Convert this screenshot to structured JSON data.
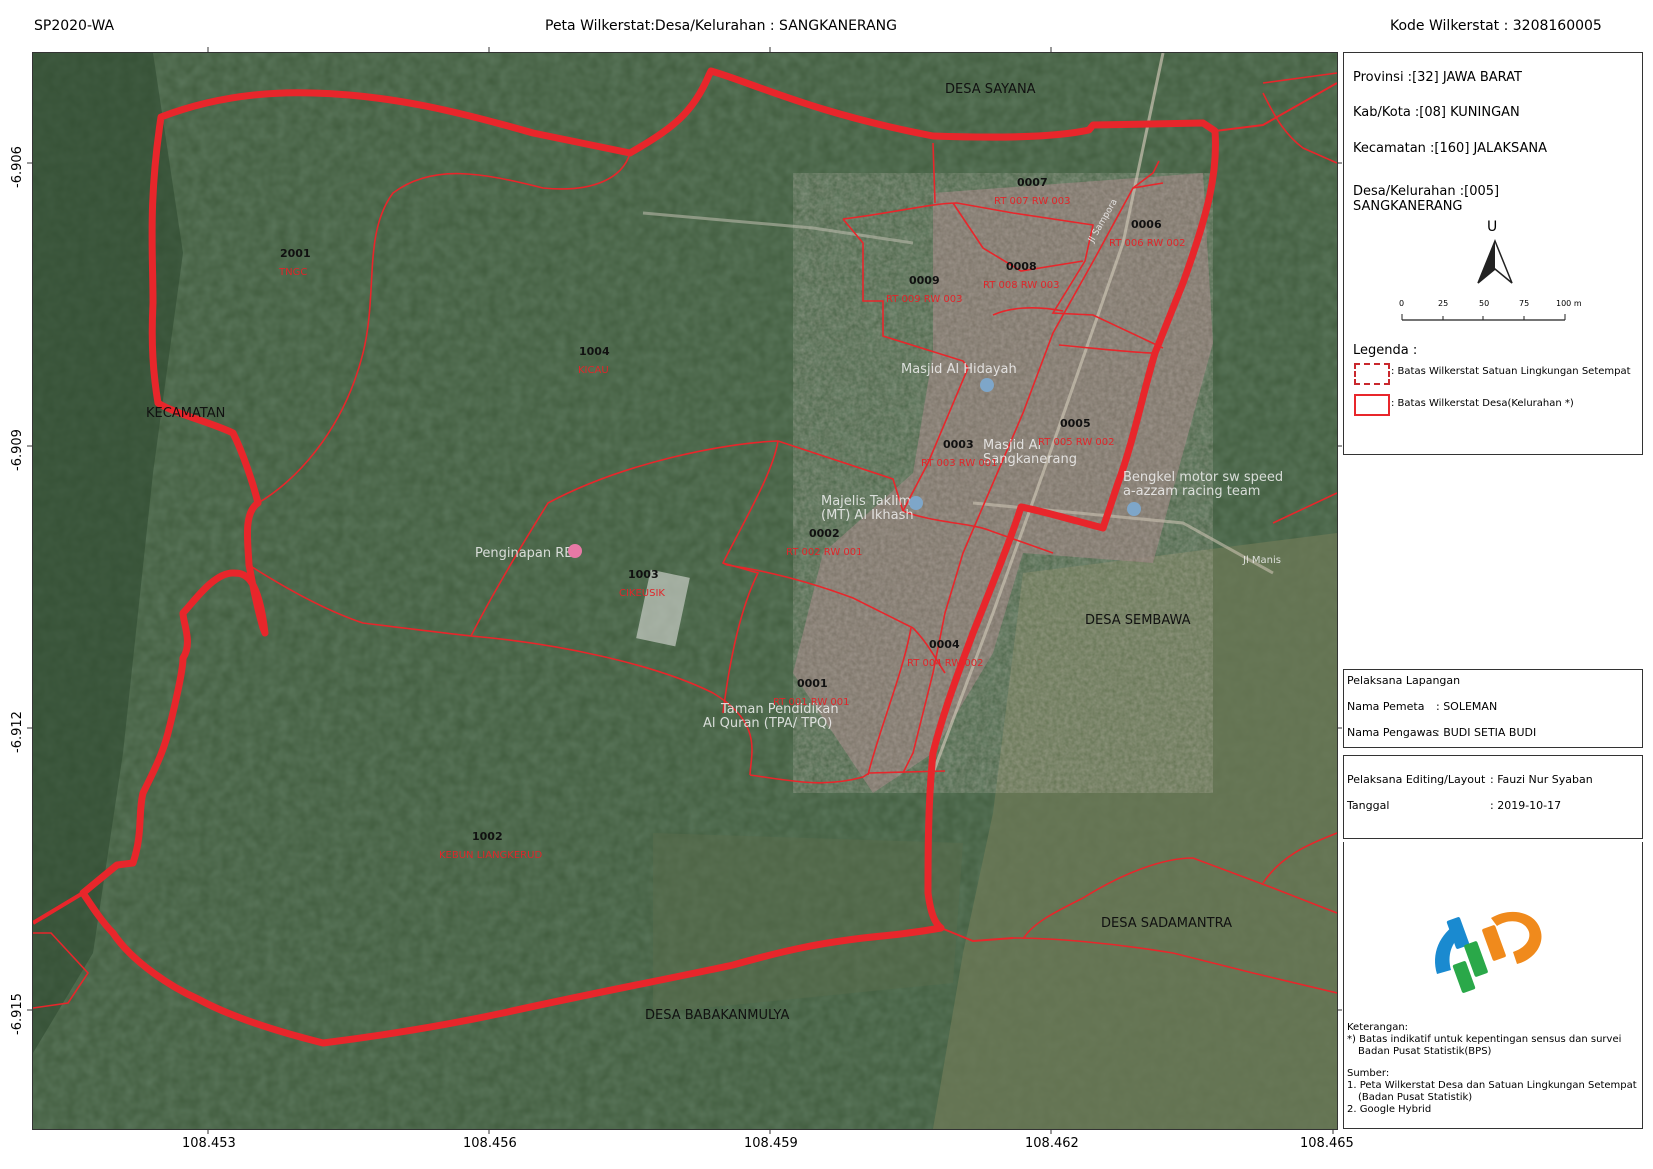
{
  "header": {
    "left": "SP2020-WA",
    "center": "Peta Wilkerstat:Desa/Kelurahan : SANGKANERANG",
    "right": "Kode Wilkerstat : 3208160005"
  },
  "axes": {
    "x_ticks": [
      "108.453",
      "108.456",
      "108.459",
      "108.462",
      "108.465"
    ],
    "y_ticks": [
      "-6.906",
      "-6.909",
      "-6.912",
      "-6.915"
    ]
  },
  "info": {
    "provinsi": "Provinsi :[32] JAWA BARAT",
    "kabkota": "Kab/Kota :[08] KUNINGAN",
    "kecamatan": "Kecamatan :[160] JALAKSANA",
    "desa_line1": "Desa/Kelurahan :[005]",
    "desa_line2": "SANGKANERANG",
    "north": "U",
    "scale": [
      "0",
      "25",
      "50",
      "75",
      "100 m"
    ],
    "legend_title": "Legenda :",
    "legend_sls": ": Batas Wilkerstat Satuan Lingkungan Setempat",
    "legend_desa": ": Batas Wilkerstat Desa(Kelurahan *)"
  },
  "fieldwork": {
    "title": "Pelaksana Lapangan",
    "pemeta_label": "Nama Pemeta",
    "pemeta_value": ": SOLEMAN",
    "pengawas_label": "Nama Pengawas",
    "pengawas_value": ": BUDI SETIA BUDI"
  },
  "editing": {
    "editor_label": "Pelaksana Editing/Layout",
    "editor_value": ": Fauzi Nur Syaban",
    "date_label": "Tanggal",
    "date_value": ": 2019-10-17"
  },
  "notes": {
    "keterangan_title": "Keterangan:",
    "keterangan_1": "*) Batas indikatif untuk kepentingan sensus dan survei",
    "keterangan_2": "Badan Pusat Statistik(BPS)",
    "sumber_title": "Sumber:",
    "sumber_1": "1. Peta Wilkerstat Desa dan Satuan Lingkungan Setempat",
    "sumber_2": "(Badan Pusat Statistik)",
    "sumber_3": "2. Google Hybrid"
  },
  "map": {
    "desa_labels": [
      "DESA SAYANA",
      "KECAMATAN",
      "DESA SEMBAWA",
      "DESA SADAMANTRA",
      "DESA BABAKANMULYA"
    ],
    "poi": [
      "Masjid Al Hidayah",
      "Masjid Al",
      "Sangkanerang",
      "Majelis Taklim",
      "(MT) Al Ikhash",
      "Penginapan RB",
      "Taman Pendidikan",
      "Al Quran (TPA/ TPQ)",
      "Bengkel motor sw speed",
      "a-azzam racing team",
      "Jl Manis",
      "Jl Sampora"
    ],
    "sls": [
      {
        "code": "2001",
        "name": "TNGC"
      },
      {
        "code": "1004",
        "name": "KICAU"
      },
      {
        "code": "1003",
        "name": "CIKEUSIK"
      },
      {
        "code": "1002",
        "name": "KEBUN LIANGKERUD"
      },
      {
        "code": "0001",
        "name": "RT 001 RW 001"
      },
      {
        "code": "0002",
        "name": "RT 002 RW 001"
      },
      {
        "code": "0003",
        "name": "RT 003 RW 001"
      },
      {
        "code": "0004",
        "name": "RT 004 RW 002"
      },
      {
        "code": "0005",
        "name": "RT 005 RW 002"
      },
      {
        "code": "0006",
        "name": "RT 006 RW 002"
      },
      {
        "code": "0007",
        "name": "RT 007 RW 003"
      },
      {
        "code": "0008",
        "name": "RT 008 RW 003"
      },
      {
        "code": "0009",
        "name": "RT 009 RW 003"
      }
    ]
  },
  "colors": {
    "boundary_desa": "#e8262b",
    "boundary_sls": "#e8262b",
    "forest": "#3f5a3d",
    "settlement": "#8a7a72"
  }
}
